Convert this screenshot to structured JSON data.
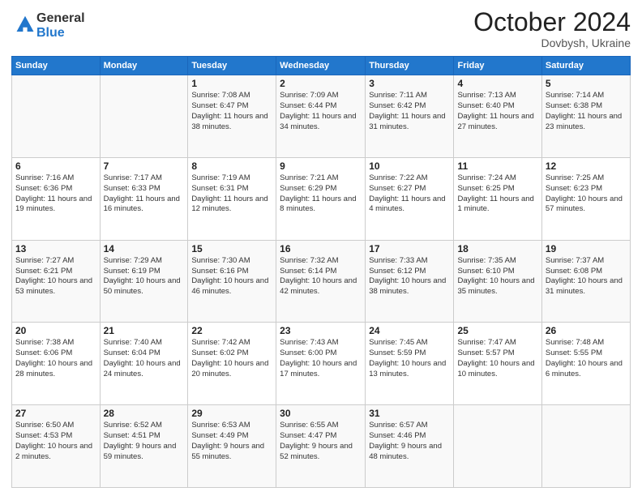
{
  "logo": {
    "general": "General",
    "blue": "Blue"
  },
  "header": {
    "month": "October 2024",
    "location": "Dovbysh, Ukraine"
  },
  "weekdays": [
    "Sunday",
    "Monday",
    "Tuesday",
    "Wednesday",
    "Thursday",
    "Friday",
    "Saturday"
  ],
  "weeks": [
    [
      {
        "day": "",
        "sunrise": "",
        "sunset": "",
        "daylight": ""
      },
      {
        "day": "",
        "sunrise": "",
        "sunset": "",
        "daylight": ""
      },
      {
        "day": "1",
        "sunrise": "Sunrise: 7:08 AM",
        "sunset": "Sunset: 6:47 PM",
        "daylight": "Daylight: 11 hours and 38 minutes."
      },
      {
        "day": "2",
        "sunrise": "Sunrise: 7:09 AM",
        "sunset": "Sunset: 6:44 PM",
        "daylight": "Daylight: 11 hours and 34 minutes."
      },
      {
        "day": "3",
        "sunrise": "Sunrise: 7:11 AM",
        "sunset": "Sunset: 6:42 PM",
        "daylight": "Daylight: 11 hours and 31 minutes."
      },
      {
        "day": "4",
        "sunrise": "Sunrise: 7:13 AM",
        "sunset": "Sunset: 6:40 PM",
        "daylight": "Daylight: 11 hours and 27 minutes."
      },
      {
        "day": "5",
        "sunrise": "Sunrise: 7:14 AM",
        "sunset": "Sunset: 6:38 PM",
        "daylight": "Daylight: 11 hours and 23 minutes."
      }
    ],
    [
      {
        "day": "6",
        "sunrise": "Sunrise: 7:16 AM",
        "sunset": "Sunset: 6:36 PM",
        "daylight": "Daylight: 11 hours and 19 minutes."
      },
      {
        "day": "7",
        "sunrise": "Sunrise: 7:17 AM",
        "sunset": "Sunset: 6:33 PM",
        "daylight": "Daylight: 11 hours and 16 minutes."
      },
      {
        "day": "8",
        "sunrise": "Sunrise: 7:19 AM",
        "sunset": "Sunset: 6:31 PM",
        "daylight": "Daylight: 11 hours and 12 minutes."
      },
      {
        "day": "9",
        "sunrise": "Sunrise: 7:21 AM",
        "sunset": "Sunset: 6:29 PM",
        "daylight": "Daylight: 11 hours and 8 minutes."
      },
      {
        "day": "10",
        "sunrise": "Sunrise: 7:22 AM",
        "sunset": "Sunset: 6:27 PM",
        "daylight": "Daylight: 11 hours and 4 minutes."
      },
      {
        "day": "11",
        "sunrise": "Sunrise: 7:24 AM",
        "sunset": "Sunset: 6:25 PM",
        "daylight": "Daylight: 11 hours and 1 minute."
      },
      {
        "day": "12",
        "sunrise": "Sunrise: 7:25 AM",
        "sunset": "Sunset: 6:23 PM",
        "daylight": "Daylight: 10 hours and 57 minutes."
      }
    ],
    [
      {
        "day": "13",
        "sunrise": "Sunrise: 7:27 AM",
        "sunset": "Sunset: 6:21 PM",
        "daylight": "Daylight: 10 hours and 53 minutes."
      },
      {
        "day": "14",
        "sunrise": "Sunrise: 7:29 AM",
        "sunset": "Sunset: 6:19 PM",
        "daylight": "Daylight: 10 hours and 50 minutes."
      },
      {
        "day": "15",
        "sunrise": "Sunrise: 7:30 AM",
        "sunset": "Sunset: 6:16 PM",
        "daylight": "Daylight: 10 hours and 46 minutes."
      },
      {
        "day": "16",
        "sunrise": "Sunrise: 7:32 AM",
        "sunset": "Sunset: 6:14 PM",
        "daylight": "Daylight: 10 hours and 42 minutes."
      },
      {
        "day": "17",
        "sunrise": "Sunrise: 7:33 AM",
        "sunset": "Sunset: 6:12 PM",
        "daylight": "Daylight: 10 hours and 38 minutes."
      },
      {
        "day": "18",
        "sunrise": "Sunrise: 7:35 AM",
        "sunset": "Sunset: 6:10 PM",
        "daylight": "Daylight: 10 hours and 35 minutes."
      },
      {
        "day": "19",
        "sunrise": "Sunrise: 7:37 AM",
        "sunset": "Sunset: 6:08 PM",
        "daylight": "Daylight: 10 hours and 31 minutes."
      }
    ],
    [
      {
        "day": "20",
        "sunrise": "Sunrise: 7:38 AM",
        "sunset": "Sunset: 6:06 PM",
        "daylight": "Daylight: 10 hours and 28 minutes."
      },
      {
        "day": "21",
        "sunrise": "Sunrise: 7:40 AM",
        "sunset": "Sunset: 6:04 PM",
        "daylight": "Daylight: 10 hours and 24 minutes."
      },
      {
        "day": "22",
        "sunrise": "Sunrise: 7:42 AM",
        "sunset": "Sunset: 6:02 PM",
        "daylight": "Daylight: 10 hours and 20 minutes."
      },
      {
        "day": "23",
        "sunrise": "Sunrise: 7:43 AM",
        "sunset": "Sunset: 6:00 PM",
        "daylight": "Daylight: 10 hours and 17 minutes."
      },
      {
        "day": "24",
        "sunrise": "Sunrise: 7:45 AM",
        "sunset": "Sunset: 5:59 PM",
        "daylight": "Daylight: 10 hours and 13 minutes."
      },
      {
        "day": "25",
        "sunrise": "Sunrise: 7:47 AM",
        "sunset": "Sunset: 5:57 PM",
        "daylight": "Daylight: 10 hours and 10 minutes."
      },
      {
        "day": "26",
        "sunrise": "Sunrise: 7:48 AM",
        "sunset": "Sunset: 5:55 PM",
        "daylight": "Daylight: 10 hours and 6 minutes."
      }
    ],
    [
      {
        "day": "27",
        "sunrise": "Sunrise: 6:50 AM",
        "sunset": "Sunset: 4:53 PM",
        "daylight": "Daylight: 10 hours and 2 minutes."
      },
      {
        "day": "28",
        "sunrise": "Sunrise: 6:52 AM",
        "sunset": "Sunset: 4:51 PM",
        "daylight": "Daylight: 9 hours and 59 minutes."
      },
      {
        "day": "29",
        "sunrise": "Sunrise: 6:53 AM",
        "sunset": "Sunset: 4:49 PM",
        "daylight": "Daylight: 9 hours and 55 minutes."
      },
      {
        "day": "30",
        "sunrise": "Sunrise: 6:55 AM",
        "sunset": "Sunset: 4:47 PM",
        "daylight": "Daylight: 9 hours and 52 minutes."
      },
      {
        "day": "31",
        "sunrise": "Sunrise: 6:57 AM",
        "sunset": "Sunset: 4:46 PM",
        "daylight": "Daylight: 9 hours and 48 minutes."
      },
      {
        "day": "",
        "sunrise": "",
        "sunset": "",
        "daylight": ""
      },
      {
        "day": "",
        "sunrise": "",
        "sunset": "",
        "daylight": ""
      }
    ]
  ]
}
